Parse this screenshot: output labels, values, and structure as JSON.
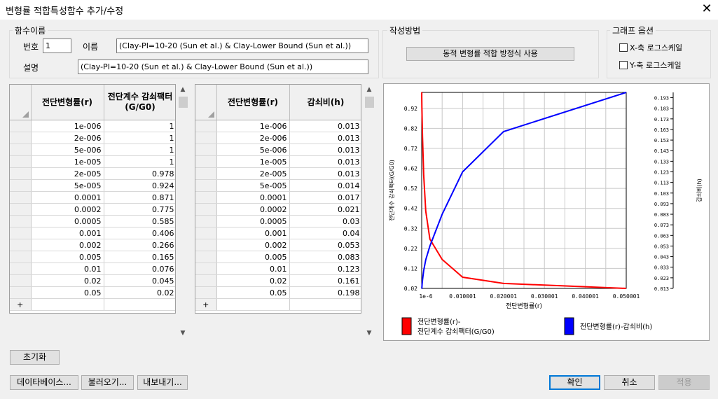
{
  "window": {
    "title": "변형률 적합특성함수 추가/수정",
    "close_glyph": "✕"
  },
  "function_name": {
    "group_label": "함수이름",
    "number_label": "번호",
    "number_value": "1",
    "name_label": "이름",
    "name_value": "(Clay-PI=10-20 (Sun et al.) & Clay-Lower Bound (Sun et al.))",
    "desc_label": "설명",
    "desc_value": "(Clay-PI=10-20 (Sun et al.) & Clay-Lower Bound (Sun et al.))"
  },
  "method": {
    "group_label": "작성방법",
    "button_label": "동적 변형률 적합 방정식 사용"
  },
  "graph_options": {
    "group_label": "그래프 옵션",
    "x_log_label": "X-축 로그스케일",
    "y_log_label": "Y-축 로그스케일",
    "x_log": false,
    "y_log": false
  },
  "table_left": {
    "col1": "전단변형률(r)",
    "col2": "전단계수 감쇠팩터 (G/G0)",
    "rows": [
      [
        "1e-006",
        "1"
      ],
      [
        "2e-006",
        "1"
      ],
      [
        "5e-006",
        "1"
      ],
      [
        "1e-005",
        "1"
      ],
      [
        "2e-005",
        "0.978"
      ],
      [
        "5e-005",
        "0.924"
      ],
      [
        "0.0001",
        "0.871"
      ],
      [
        "0.0002",
        "0.775"
      ],
      [
        "0.0005",
        "0.585"
      ],
      [
        "0.001",
        "0.406"
      ],
      [
        "0.002",
        "0.266"
      ],
      [
        "0.005",
        "0.165"
      ],
      [
        "0.01",
        "0.076"
      ],
      [
        "0.02",
        "0.045"
      ],
      [
        "0.05",
        "0.02"
      ]
    ],
    "add_row": "+"
  },
  "table_right": {
    "col1": "전단변형률(r)",
    "col2": "감쇠비(h)",
    "rows": [
      [
        "1e-006",
        "0.013"
      ],
      [
        "2e-006",
        "0.013"
      ],
      [
        "5e-006",
        "0.013"
      ],
      [
        "1e-005",
        "0.013"
      ],
      [
        "2e-005",
        "0.013"
      ],
      [
        "5e-005",
        "0.014"
      ],
      [
        "0.0001",
        "0.017"
      ],
      [
        "0.0002",
        "0.021"
      ],
      [
        "0.0005",
        "0.03"
      ],
      [
        "0.001",
        "0.04"
      ],
      [
        "0.002",
        "0.053"
      ],
      [
        "0.005",
        "0.083"
      ],
      [
        "0.01",
        "0.123"
      ],
      [
        "0.02",
        "0.161"
      ],
      [
        "0.05",
        "0.198"
      ]
    ],
    "add_row": "+"
  },
  "chart_data": {
    "type": "line",
    "xlabel": "전단변형률(r)",
    "ylabel_left": "전단계수 감쇠팩터(G/G0)",
    "ylabel_right": "감쇠비(h)",
    "xlim": [
      1e-06,
      0.050001
    ],
    "ylim_left": [
      0.02,
      1.0
    ],
    "ylim_right": [
      0.013,
      0.198
    ],
    "x_ticks": [
      "1e-6",
      "0.010001",
      "0.020001",
      "0.030001",
      "0.040001",
      "0.050001"
    ],
    "y_ticks_left": [
      "0.92",
      "0.82",
      "0.72",
      "0.62",
      "0.52",
      "0.42",
      "0.32",
      "0.22",
      "0.12",
      "0.02"
    ],
    "y_ticks_right": [
      "0.193",
      "0.183",
      "0.173",
      "0.163",
      "0.153",
      "0.143",
      "0.133",
      "0.123",
      "0.113",
      "0.103",
      "0.093",
      "0.083",
      "0.073",
      "0.063",
      "0.053",
      "0.043",
      "0.033",
      "0.023",
      "0.013"
    ],
    "grid": true,
    "series": [
      {
        "name": "전단변형률(r)-전단계수 감쇠팩터(G/G0)",
        "axis": "left",
        "color": "#ff0000",
        "x": [
          1e-06,
          2e-06,
          5e-06,
          1e-05,
          2e-05,
          5e-05,
          0.0001,
          0.0002,
          0.0005,
          0.001,
          0.002,
          0.005,
          0.01,
          0.02,
          0.05
        ],
        "y": [
          1,
          1,
          1,
          1,
          0.978,
          0.924,
          0.871,
          0.775,
          0.585,
          0.406,
          0.266,
          0.165,
          0.076,
          0.045,
          0.02
        ]
      },
      {
        "name": "전단변형률(r)-감쇠비(h)",
        "axis": "right",
        "color": "#0000ff",
        "x": [
          1e-06,
          2e-06,
          5e-06,
          1e-05,
          2e-05,
          5e-05,
          0.0001,
          0.0002,
          0.0005,
          0.001,
          0.002,
          0.005,
          0.01,
          0.02,
          0.05
        ],
        "y": [
          0.013,
          0.013,
          0.013,
          0.013,
          0.013,
          0.014,
          0.017,
          0.021,
          0.03,
          0.04,
          0.053,
          0.083,
          0.123,
          0.161,
          0.198
        ]
      }
    ],
    "legend": [
      {
        "line1": "전단변형률(r)-",
        "line2": "전단계수 감쇠팩터(G/G0)",
        "color": "#ff0000"
      },
      {
        "line1": "전단변형률(r)-감쇠비(h)",
        "color": "#0000ff"
      }
    ]
  },
  "buttons": {
    "reset": "초기화",
    "database": "데이타베이스...",
    "load": "불러오기...",
    "export": "내보내기...",
    "ok": "확인",
    "cancel": "취소",
    "apply": "적용"
  }
}
